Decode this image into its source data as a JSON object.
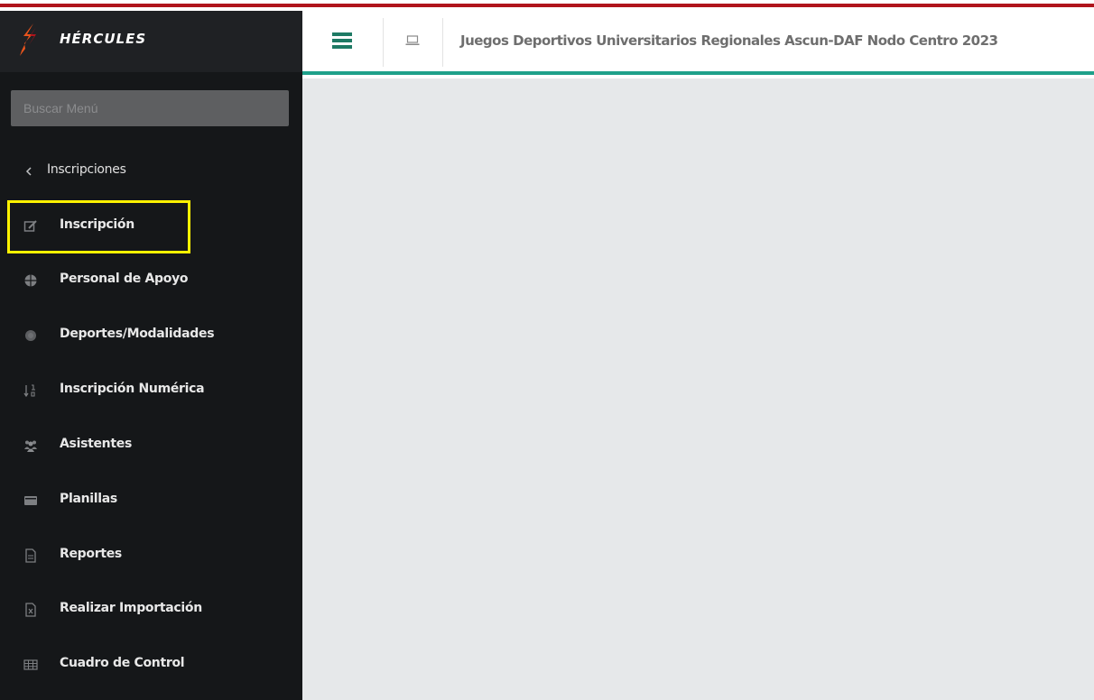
{
  "brand": {
    "name": "HÉRCULES",
    "colors": {
      "red": "#b0141c",
      "orange": "#e8541c"
    }
  },
  "search": {
    "placeholder": "Buscar Menú"
  },
  "nav": {
    "back": {
      "label": "Inscripciones",
      "icon": "chevron-left-icon"
    },
    "items": [
      {
        "label": "Inscripción",
        "icon": "edit-icon"
      },
      {
        "label": "Personal de Apoyo",
        "icon": "globe-icon"
      },
      {
        "label": "Deportes/Modalidades",
        "icon": "circle-icon"
      },
      {
        "label": "Inscripción Numérica",
        "icon": "sort-numeric-icon"
      },
      {
        "label": "Asistentes",
        "icon": "users-icon"
      },
      {
        "label": "Planillas",
        "icon": "credit-card-icon"
      },
      {
        "label": "Reportes",
        "icon": "file-icon"
      },
      {
        "label": "Realizar Importación",
        "icon": "file-excel-icon"
      },
      {
        "label": "Cuadro de Control",
        "icon": "table-icon"
      }
    ],
    "highlighted": "Inscripción"
  },
  "header": {
    "title": "Juegos Deportivos Universitarios Regionales Ascun-DAF Nodo Centro 2023",
    "accent_color": "#1ea08a"
  }
}
